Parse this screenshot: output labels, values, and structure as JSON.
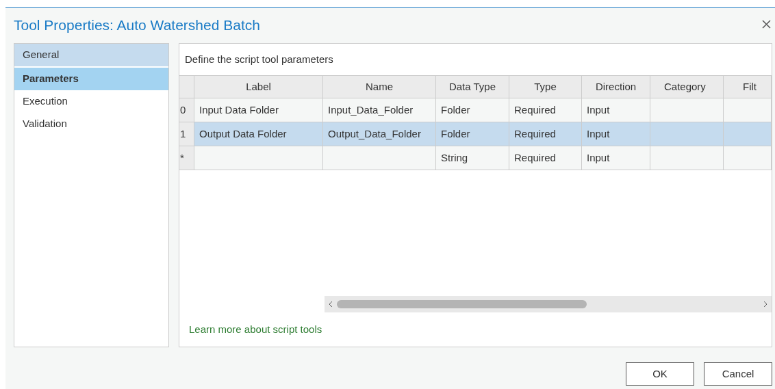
{
  "window": {
    "title": "Tool Properties: Auto Watershed Batch"
  },
  "sidebar": {
    "items": [
      {
        "label": "General",
        "selected": false,
        "hovered": true
      },
      {
        "label": "Parameters",
        "selected": true,
        "hovered": false
      },
      {
        "label": "Execution",
        "selected": false,
        "hovered": false
      },
      {
        "label": "Validation",
        "selected": false,
        "hovered": false
      }
    ]
  },
  "panel": {
    "heading": "Define the script tool parameters",
    "table": {
      "columns": [
        "Label",
        "Name",
        "Data Type",
        "Type",
        "Direction",
        "Category",
        "Filt"
      ],
      "rows": [
        {
          "marker": "0",
          "selected": false,
          "cells": {
            "label": "Input Data Folder",
            "name": "Input_Data_Folder",
            "data_type": "Folder",
            "type": "Required",
            "direction": "Input"
          }
        },
        {
          "marker": "1",
          "selected": true,
          "cells": {
            "label": "Output Data Folder",
            "name": "Output_Data_Folder",
            "data_type": "Folder",
            "type": "Required",
            "direction": "Input"
          }
        },
        {
          "marker": "*",
          "selected": false,
          "cells": {
            "data_type": "String",
            "type": "Required",
            "direction": "Input"
          }
        }
      ]
    },
    "link": "Learn more about script tools"
  },
  "buttons": [
    "OK",
    "Cancel"
  ]
}
